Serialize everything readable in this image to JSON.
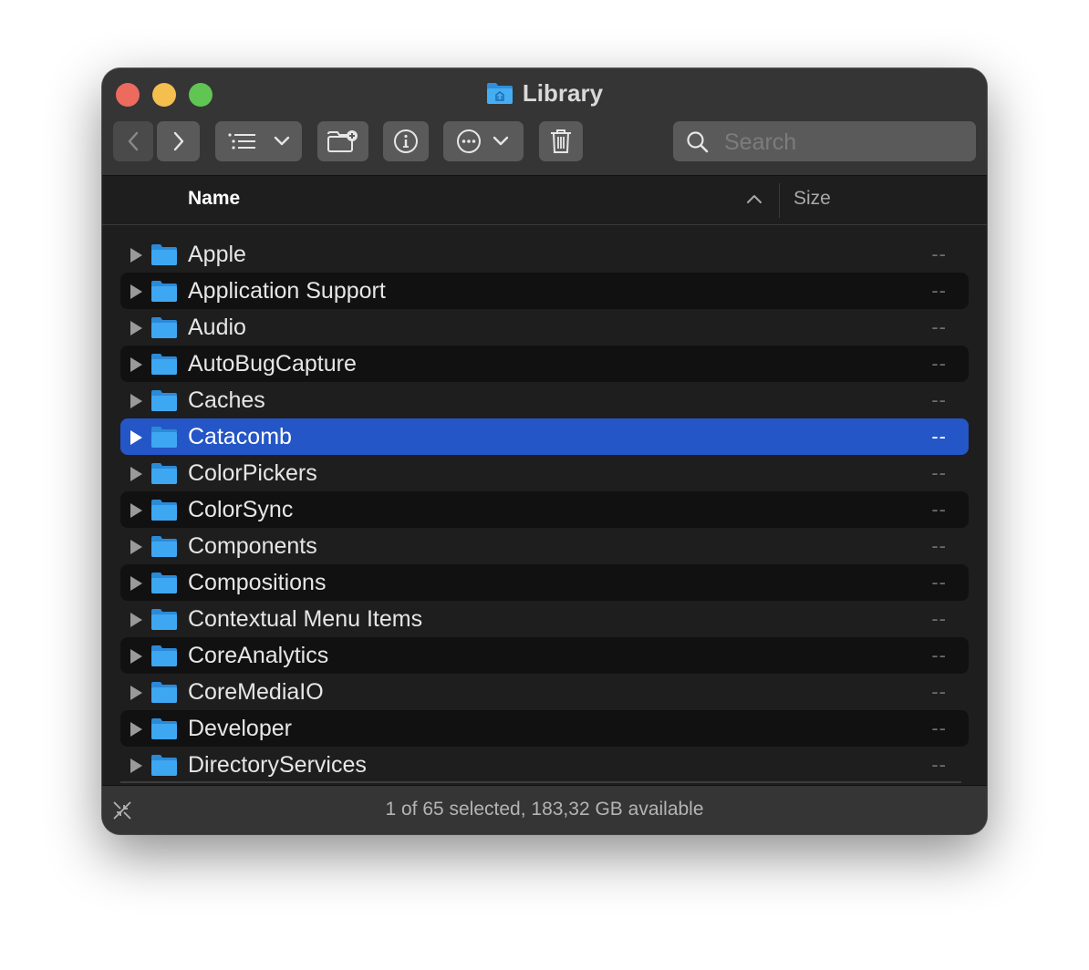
{
  "window": {
    "title": "Library"
  },
  "toolbar": {
    "back": "chevron-left-icon",
    "forward": "chevron-right-icon",
    "view_options": "list-view-icon",
    "new_folder": "new-folder-icon",
    "info": "info-icon",
    "more": "ellipsis-circle-icon",
    "trash": "trash-icon"
  },
  "search": {
    "placeholder": "Search",
    "value": ""
  },
  "columns": {
    "name": "Name",
    "size": "Size",
    "sort_direction": "ascending"
  },
  "files": [
    {
      "name": "Apple",
      "size": "--"
    },
    {
      "name": "Application Support",
      "size": "--"
    },
    {
      "name": "Audio",
      "size": "--"
    },
    {
      "name": "AutoBugCapture",
      "size": "--"
    },
    {
      "name": "Caches",
      "size": "--"
    },
    {
      "name": "Catacomb",
      "size": "--",
      "selected": true
    },
    {
      "name": "ColorPickers",
      "size": "--"
    },
    {
      "name": "ColorSync",
      "size": "--"
    },
    {
      "name": "Components",
      "size": "--"
    },
    {
      "name": "Compositions",
      "size": "--"
    },
    {
      "name": "Contextual Menu Items",
      "size": "--"
    },
    {
      "name": "CoreAnalytics",
      "size": "--"
    },
    {
      "name": "CoreMediaIO",
      "size": "--"
    },
    {
      "name": "Developer",
      "size": "--"
    },
    {
      "name": "DirectoryServices",
      "size": "--"
    }
  ],
  "status": {
    "text": "1 of 65 selected, 183,32 GB available"
  },
  "colors": {
    "selection": "#2456c7",
    "folder": "#3ea7f2",
    "close": "#ed6a5e",
    "minimize": "#f4bf4f",
    "maximize": "#61c554"
  }
}
